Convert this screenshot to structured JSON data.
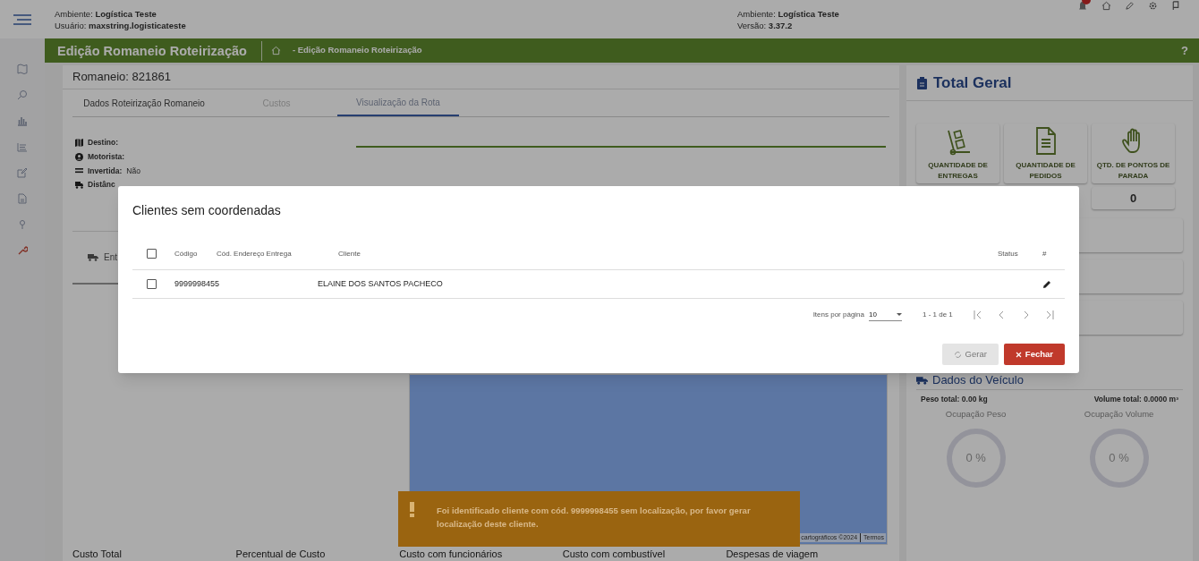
{
  "header": {
    "left": [
      {
        "label": "Ambiente:",
        "value": "Logística Teste"
      },
      {
        "label": "Usuário:",
        "value": "maxstring.logisticateste"
      }
    ],
    "right": [
      {
        "label": "Ambiente:",
        "value": "Logística Teste"
      },
      {
        "label": "Versão:",
        "value": "3.37.2"
      }
    ]
  },
  "title_bar": {
    "title": "Edição Romaneio Roteirização",
    "breadcrumb": "- Edição Romaneio Roteirização",
    "help": "?"
  },
  "romaneio": {
    "title": "Romaneio: 821861",
    "tabs": [
      {
        "label": "Dados Roteirização Romaneio",
        "selected": false,
        "disabled": false
      },
      {
        "label": "Custos",
        "selected": false,
        "disabled": true
      },
      {
        "label": "Visualização da Rota",
        "selected": true,
        "disabled": false
      }
    ],
    "info": [
      {
        "kind": "map",
        "label": "Destino:"
      },
      {
        "kind": "person",
        "label": "Motorista:"
      },
      {
        "kind": "equals",
        "label": "Invertida:",
        "value": "Não"
      },
      {
        "kind": "truck",
        "label": "Distânc"
      }
    ],
    "sub_tab": "Ent",
    "map_attribution": [
      "cartográficos ©2024",
      "Termos"
    ],
    "costs": [
      "Custo Total",
      "Percentual de Custo",
      "Custo com funcionários",
      "Custo com combustível",
      "Despesas de viagem"
    ]
  },
  "total_geral": {
    "title": "Total Geral",
    "cards": [
      {
        "kind": "dolly",
        "label": "QUANTIDADE DE ENTREGAS"
      },
      {
        "kind": "document",
        "label": "QUANTIDADE DE PEDIDOS"
      },
      {
        "kind": "hand",
        "label": "QTD. DE PONTOS DE PARADA",
        "value": "0"
      }
    ]
  },
  "vehicle": {
    "title": "Dados do Veículo",
    "weight": "Peso total: 0.00 kg",
    "volume": "Volume total: 0.0000 m³",
    "gauges": [
      {
        "label": "Ocupação Peso",
        "value": "0 %"
      },
      {
        "label": "Ocupação Volume",
        "value": "0 %"
      }
    ]
  },
  "modal": {
    "title": "Clientes sem coordenadas",
    "select_all_checked": false,
    "columns": [
      "Código",
      "Cód. Endereço Entrega",
      "Cliente",
      "Status",
      "#"
    ],
    "rows": [
      {
        "checked": false,
        "code": "9999998455",
        "client": "ELAINE DOS SANTOS PACHECO"
      }
    ],
    "items_per_page_label": "Itens por página",
    "items_per_page": "10",
    "range": "1 - 1 de 1",
    "buttons": [
      {
        "kind": "generate",
        "label": "Gerar",
        "disabled": true
      },
      {
        "kind": "close",
        "label": "Fechar",
        "disabled": false
      }
    ]
  },
  "toast": {
    "message": "Foi identificado cliente com cód. 9999998455 sem localização, por favor gerar localização deste cliente."
  }
}
